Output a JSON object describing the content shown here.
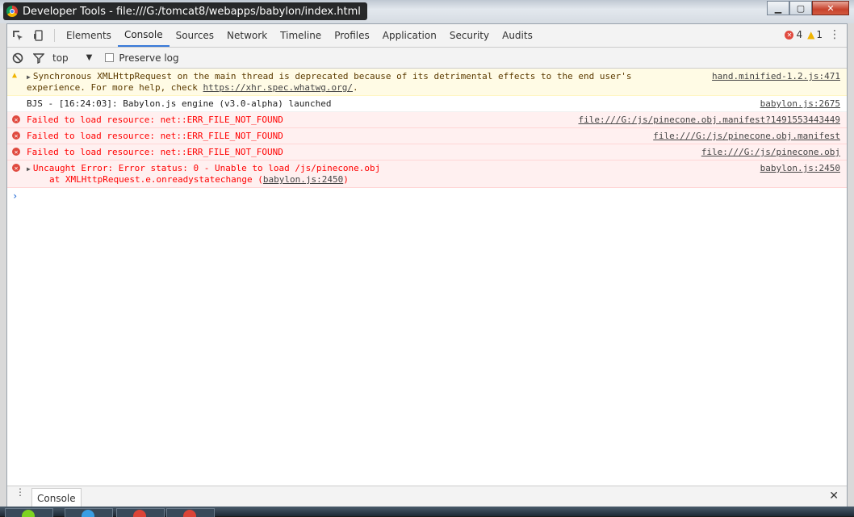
{
  "window": {
    "title": "Developer Tools - file:///G:/tomcat8/webapps/babylon/index.html",
    "controls": {
      "minimize": "▁",
      "maximize": "▢",
      "close": "✕"
    }
  },
  "toolbar": {
    "tabs": [
      "Elements",
      "Console",
      "Sources",
      "Network",
      "Timeline",
      "Profiles",
      "Application",
      "Security",
      "Audits"
    ],
    "active_tab": "Console",
    "error_count": "4",
    "warning_count": "1"
  },
  "filter": {
    "context": "top",
    "preserve_log_label": "Preserve log"
  },
  "console_rows": [
    {
      "level": "warning",
      "text": "Synchronous XMLHttpRequest on the main thread is deprecated because of its detrimental effects to the end user's",
      "text2_prefix": "experience. For more help, check ",
      "link": "https://xhr.spec.whatwg.org/",
      "text2_suffix": ".",
      "source": "hand.minified-1.2.js:471"
    },
    {
      "level": "info",
      "text": "BJS - [16:24:03]: Babylon.js engine (v3.0-alpha) launched",
      "source": "babylon.js:2675"
    },
    {
      "level": "error",
      "text": "Failed to load resource: net::ERR_FILE_NOT_FOUND",
      "source": "file:///G:/js/pinecone.obj.manifest?1491553443449"
    },
    {
      "level": "error",
      "text": "Failed to load resource: net::ERR_FILE_NOT_FOUND",
      "source": "file:///G:/js/pinecone.obj.manifest"
    },
    {
      "level": "error",
      "text": "Failed to load resource: net::ERR_FILE_NOT_FOUND",
      "source": "file:///G:/js/pinecone.obj"
    },
    {
      "level": "error",
      "text": "Uncaught Error: Error status: 0 - Unable to load /js/pinecone.obj",
      "stack_prefix": "at XMLHttpRequest.e.onreadystatechange (",
      "stack_link": "babylon.js:2450",
      "stack_suffix": ")",
      "source": "babylon.js:2450"
    }
  ],
  "prompt": "›",
  "drawer": {
    "tab": "Console",
    "close": "✕"
  },
  "colors": {
    "accent": "#3879d9",
    "error": "#ff0000",
    "error_bg": "#fff0f0",
    "warning_bg": "#fffbe5"
  }
}
